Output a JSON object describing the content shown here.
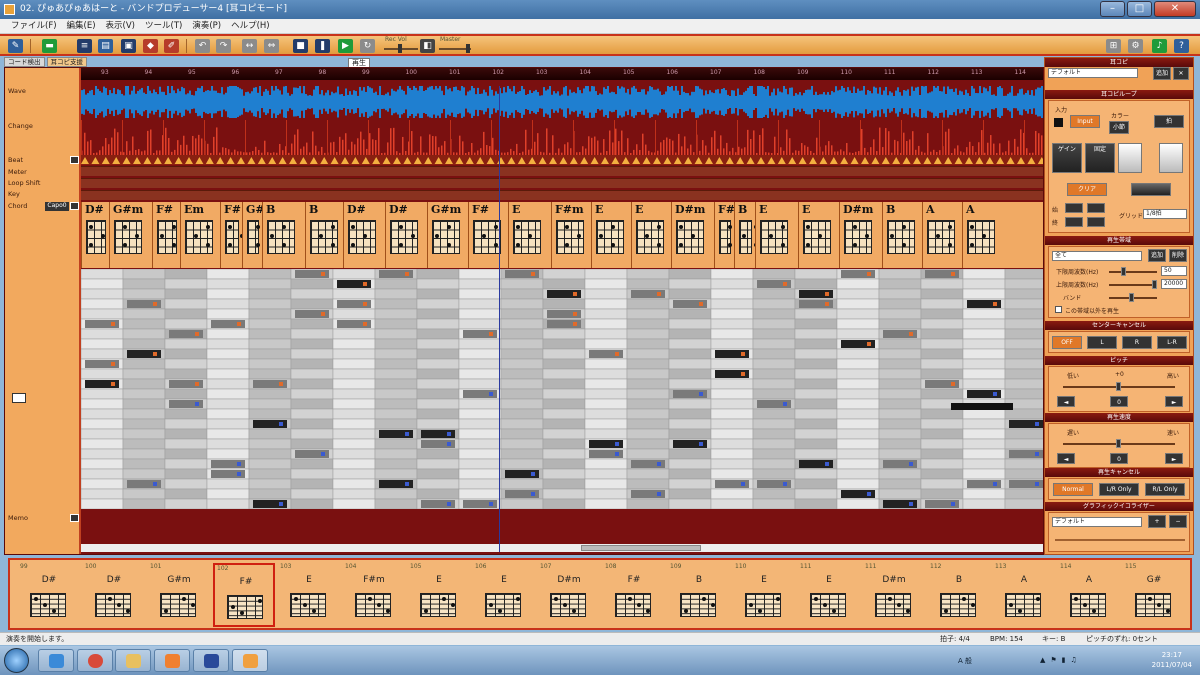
{
  "window": {
    "title": "02. ぴゅあぴゅあはーと - バンドプロデューサー4 [耳コピモード]"
  },
  "menu": [
    "ファイル(F)",
    "編集(E)",
    "表示(V)",
    "ツール(T)",
    "演奏(P)",
    "ヘルプ(H)"
  ],
  "toolbar": {
    "play_tooltip": "再生",
    "slider1_label": "Rec Vol",
    "slider2_label": "Master"
  },
  "tabs": [
    "コード検出",
    "耳コピ支援"
  ],
  "ruler": [
    "93",
    "94",
    "95",
    "96",
    "97",
    "98",
    "99",
    "100",
    "101",
    "102",
    "103",
    "104",
    "105",
    "106",
    "107",
    "108",
    "109",
    "110",
    "111",
    "112",
    "113",
    "114"
  ],
  "tracks": {
    "wave": "Wave",
    "change": "Change",
    "beat": "Beat",
    "meter": "Meter",
    "loop": "Loop Shift",
    "key": "Key",
    "chord": "Chord",
    "capo": "Capo0",
    "memo": "Memo"
  },
  "chords": [
    "D#",
    "G#m",
    "F#",
    "Em",
    "F#",
    "G#m",
    "B",
    "B",
    "D#",
    "D#",
    "G#m",
    "F#",
    "E",
    "F#m",
    "E",
    "E",
    "D#m",
    "F#",
    "B",
    "E",
    "E",
    "D#m",
    "B",
    "A",
    "A"
  ],
  "right_panel": {
    "header": "耳コピ",
    "preset": "デフォルト",
    "preset_btn": "追加",
    "loop_header": "耳コピループ",
    "input_label": "入力",
    "input_btn": "Input",
    "color_label": "カラー",
    "btn_a": "小節",
    "btn_b": "拍",
    "btn_c": "ゲイン",
    "btn_d": "固定",
    "btn_e": "クリア",
    "from_label": "始",
    "to_label": "終",
    "grid_label": "グリッド",
    "grid_value": "1/8拍",
    "play_header": "再生帯域",
    "eq_value": "全て",
    "eq_btn1": "追加",
    "eq_btn2": "削除",
    "low_label": "下限周波数(Hz)",
    "low_value": "50",
    "high_label": "上限周波数(Hz)",
    "high_value": "20000",
    "band_label": "バンド",
    "band_check": "この帯域以外を再生",
    "center_header": "センターキャンセル",
    "center_btns": [
      "OFF",
      "L",
      "R",
      "L-R"
    ],
    "pitch_header": "ピッチ",
    "pitch_low": "低い",
    "pitch_high": "高い",
    "pitch_mid": "+0",
    "speed_header": "再生速度",
    "speed_low": "遅い",
    "speed_high": "速い",
    "cancel_header": "再生キャンセル",
    "cancel_btns": [
      "Normal",
      "L/R Only",
      "R/L Only"
    ],
    "gfx_header": "グラフィックイコライザー",
    "gfx_value": "デフォルト"
  },
  "bottom_chords": [
    {
      "num": "99",
      "name": "D#"
    },
    {
      "num": "100",
      "name": "D#"
    },
    {
      "num": "101",
      "name": "G#m"
    },
    {
      "num": "102",
      "name": "F#"
    },
    {
      "num": "103",
      "name": "E"
    },
    {
      "num": "104",
      "name": "F#m"
    },
    {
      "num": "105",
      "name": "E"
    },
    {
      "num": "106",
      "name": "E"
    },
    {
      "num": "107",
      "name": "D#m"
    },
    {
      "num": "108",
      "name": "F#"
    },
    {
      "num": "109",
      "name": "B"
    },
    {
      "num": "110",
      "name": "E"
    },
    {
      "num": "111",
      "name": "E"
    },
    {
      "num": "111",
      "name": "D#m"
    },
    {
      "num": "112",
      "name": "B"
    },
    {
      "num": "113",
      "name": "A"
    },
    {
      "num": "114",
      "name": "A"
    },
    {
      "num": "115",
      "name": "G#"
    }
  ],
  "status": {
    "left": "演奏を開始します。",
    "meter": "拍子: 4/4",
    "bpm": "BPM: 154",
    "key": "キー: B",
    "pitch": "ピッチのずれ: 0セント"
  },
  "taskbar": {
    "ime": "A 般",
    "time": "23:17",
    "date": "2011/07/04"
  }
}
